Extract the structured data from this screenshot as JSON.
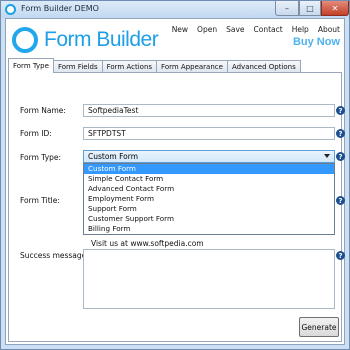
{
  "window": {
    "title": "Form Builder DEMO",
    "minimize": "–",
    "maximize": "□",
    "close": "✕"
  },
  "brand": {
    "name": "Form Builder"
  },
  "menu": {
    "new": "New",
    "open": "Open",
    "save": "Save",
    "contact": "Contact",
    "help": "Help",
    "about": "About",
    "buy_now": "Buy Now"
  },
  "tabs": [
    {
      "label": "Form Type",
      "active": true
    },
    {
      "label": "Form Fields",
      "active": false
    },
    {
      "label": "Form Actions",
      "active": false
    },
    {
      "label": "Form Appearance",
      "active": false
    },
    {
      "label": "Advanced Options",
      "active": false
    }
  ],
  "form": {
    "name_label": "Form Name:",
    "name_value": "SoftpediaTest",
    "id_label": "Form ID:",
    "id_value": "SFTPDTST",
    "type_label": "Form Type:",
    "type_value": "Custom Form",
    "type_options": [
      "Custom Form",
      "Simple Contact Form",
      "Advanced Contact Form",
      "Employment Form",
      "Support Form",
      "Customer Support Form",
      "Billing Form"
    ],
    "title_label": "Form Title:",
    "visit_text": "Visit us at www.softpedia.com",
    "success_label": "Success message:",
    "help_glyph": "?"
  },
  "actions": {
    "generate": "Generate"
  }
}
